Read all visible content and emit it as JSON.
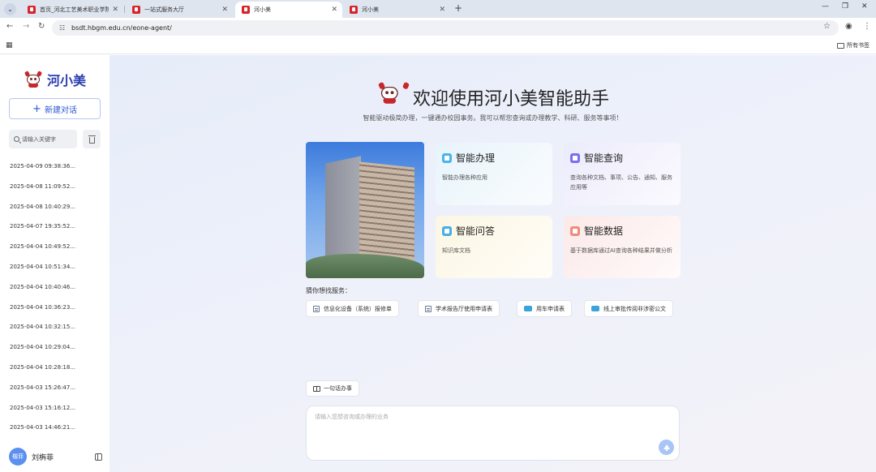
{
  "browser": {
    "tabs": [
      {
        "title": "首页_河北工艺美术职业学院",
        "active": false
      },
      {
        "title": "一站式服务大厅",
        "active": false
      },
      {
        "title": "河小美",
        "active": true
      },
      {
        "title": "河小美",
        "active": false
      }
    ],
    "url": "bsdt.hbgm.edu.cn/eone-agent/",
    "bookmarks_label": "所有书签"
  },
  "sidebar": {
    "brand": "河小美",
    "new_chat_label": "新建对话",
    "search_placeholder": "请输入关键字",
    "history": [
      "2025-04-09 09:38:36...",
      "2025-04-08 11:09:52...",
      "2025-04-08 10:40:29...",
      "2025-04-07 19:35:52...",
      "2025-04-04 10:49:52...",
      "2025-04-04 10:51:34...",
      "2025-04-04 10:40:46...",
      "2025-04-04 10:36:23...",
      "2025-04-04 10:32:15...",
      "2025-04-04 10:29:04...",
      "2025-04-04 10:28:18...",
      "2025-04-03 15:26:47...",
      "2025-04-03 15:16:12...",
      "2025-04-03 14:46:21..."
    ],
    "user": {
      "avatar_text": "楷菲",
      "name": "刘栴菲"
    }
  },
  "main": {
    "title": "欢迎使用河小美智能助手",
    "subtitle": "智能驱动极简办理，一键通办校园事务。我可以帮您查询或办理教学、科研、服务等事项！",
    "cards": [
      {
        "title": "智能办理",
        "desc": "智能办理各种应用",
        "icon": "home-icon",
        "color": "#4db3ea"
      },
      {
        "title": "智能查询",
        "desc": "查询各种文档、事项、公告、通知、服务应用等",
        "icon": "person-icon",
        "color": "#7a6ff0"
      },
      {
        "title": "智能问答",
        "desc": "知识库文档",
        "icon": "chat-icon",
        "color": "#47aee6"
      },
      {
        "title": "智能数据",
        "desc": "基于数据库通过AI查询各种结果并做分析",
        "icon": "speaker-icon",
        "color": "#f08a7a"
      }
    ],
    "guess_label": "猜你想找服务：",
    "services": [
      {
        "label": "信息化设备（系统）报修单",
        "icon": "doc-icon"
      },
      {
        "label": "学术报告厅使用申请表",
        "icon": "doc-icon"
      },
      {
        "label": "用车申请表",
        "icon": "car-icon"
      },
      {
        "label": "线上审批传阅非涉密公文",
        "icon": "car-icon"
      }
    ],
    "quick_label": "一句话办事",
    "input_placeholder": "请输入您想咨询或办理的业务"
  }
}
